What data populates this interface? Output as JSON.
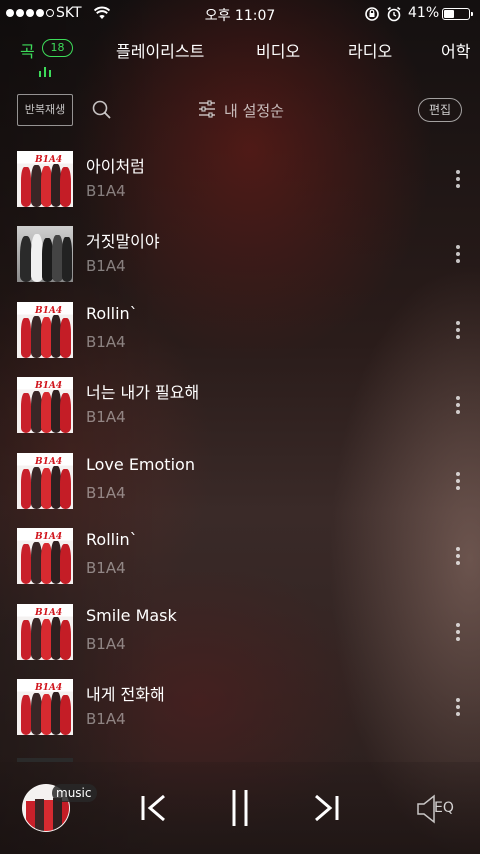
{
  "status_bar": {
    "carrier": "SKT",
    "time": "오후 11:07",
    "battery_percent": "41%",
    "battery_level": 0.41,
    "signal_bars_filled": 4,
    "signal_bars_total": 5
  },
  "tabs": {
    "items": [
      {
        "label": "곡",
        "active": true,
        "count": "18"
      },
      {
        "label": "플레이리스트",
        "active": false
      },
      {
        "label": "비디오",
        "active": false
      },
      {
        "label": "라디오",
        "active": false
      },
      {
        "label": "어학",
        "active": false
      }
    ],
    "accent_color": "#3ddc5a"
  },
  "toolbar": {
    "repeat_label": "반복재생",
    "sort_label": "내 설정순",
    "edit_label": "편집"
  },
  "songs": [
    {
      "title": "아이처럼",
      "artist": "B1A4",
      "art": "color"
    },
    {
      "title": "거짓말이야",
      "artist": "B1A4",
      "art": "bw"
    },
    {
      "title": "Rollin`",
      "artist": "B1A4",
      "art": "color"
    },
    {
      "title": "너는 내가 필요해",
      "artist": "B1A4",
      "art": "color"
    },
    {
      "title": "Love Emotion",
      "artist": "B1A4",
      "art": "color"
    },
    {
      "title": "Rollin`",
      "artist": "B1A4",
      "art": "color"
    },
    {
      "title": "Smile Mask",
      "artist": "B1A4",
      "art": "color"
    },
    {
      "title": "내게 전화해",
      "artist": "B1A4",
      "art": "color"
    }
  ],
  "player": {
    "badge_label": "music",
    "eq_label": "EQ"
  }
}
